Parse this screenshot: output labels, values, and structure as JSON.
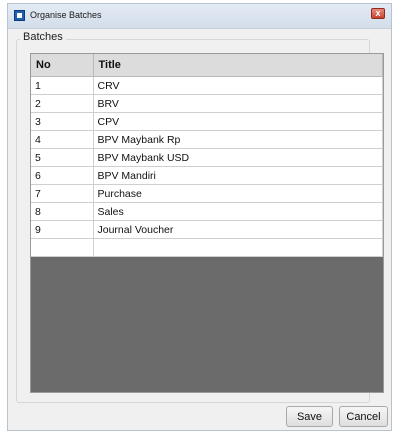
{
  "window": {
    "title": "Organise Batches",
    "close_glyph": "x"
  },
  "group": {
    "label": "Batches"
  },
  "table": {
    "columns": [
      "No",
      "Title"
    ],
    "rows": [
      [
        "1",
        "CRV"
      ],
      [
        "2",
        "BRV"
      ],
      [
        "3",
        "CPV"
      ],
      [
        "4",
        "BPV Maybank Rp"
      ],
      [
        "5",
        "BPV Maybank USD"
      ],
      [
        "6",
        "BPV Mandiri"
      ],
      [
        "7",
        "Purchase"
      ],
      [
        "8",
        "Sales"
      ],
      [
        "9",
        "Journal Voucher"
      ],
      [
        "",
        ""
      ]
    ]
  },
  "buttons": {
    "save": "Save",
    "cancel": "Cancel"
  },
  "colors": {
    "grid_empty_area": "#6b6b6b",
    "header_bg": "#dcdcdc",
    "close_button": "#c9442f"
  },
  "icons": {
    "app": "app-window-icon",
    "close": "close-icon"
  }
}
